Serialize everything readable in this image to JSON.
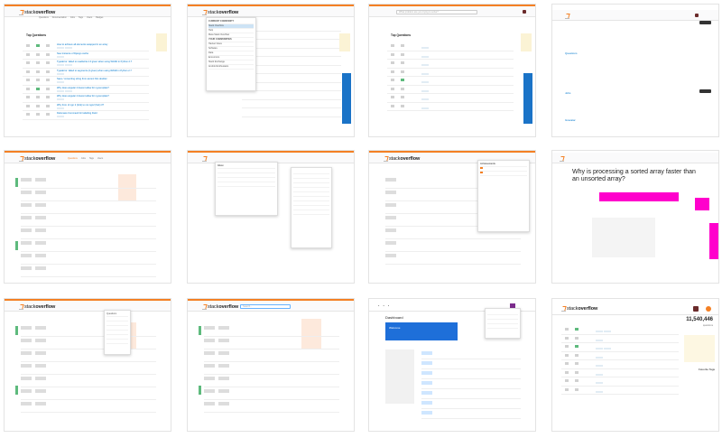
{
  "brand": {
    "name_light": "stack",
    "name_bold": "overflow",
    "accent": "#f48024",
    "link": "#0077cc"
  },
  "tiles": [
    {
      "search": "",
      "nav": [
        "Questions",
        "Documentation",
        "Jobs",
        "Tags",
        "Users",
        "Badges"
      ],
      "section": "Top Questions",
      "questions": [
        "How to achieve all elements swapped in an array",
        "New instance of Django cache",
        "TypeError: failed to read/write it if given when using WASD in Python 2.7",
        "TypeError: failed to segments (2 given) when using WASD in Python 2.7",
        "Save / converting string from accent first doubler",
        "Why does angular 4 doesnt allow for ng-template?",
        "Why does angular 4 doesnt allow for ng-template?",
        "Why from of ngn 2 (fork) to not ngn2 (fork) 3?",
        "Delomass Command for labelling Field"
      ]
    },
    {
      "dropdown_title": "CURRENT COMMUNITY",
      "dropdown_items": [
        "Stack Overflow",
        "Help",
        "Meta Stack Overflow",
        "YOUR COMMUNITIES",
        "Hacker News",
        "Software",
        "Data",
        "Economics",
        "Stack Exchange",
        "Android Enthusiasts"
      ]
    },
    {
      "search": "What problem are you trying to solve?",
      "section": "Top Questions"
    },
    {
      "labels": [
        "Questions",
        "Jobs",
        "Gravatar"
      ]
    },
    {
      "nav": [
        "Questions",
        "Jobs",
        "Tags",
        "Users"
      ]
    },
    {
      "panel_title": "Inbox"
    },
    {
      "panel_title": "Achievements"
    },
    {
      "question_title": "Why is processing a sorted array faster than an unsorted array?"
    },
    {
      "menu_title": "Questions"
    },
    {
      "search": "Search..."
    },
    {
      "header": "Dashboard",
      "sub": "Welcome"
    },
    {
      "title": "Stack Overflow",
      "count": "11,540,446",
      "count_label": "questions",
      "section": "Favorite Tags"
    }
  ]
}
